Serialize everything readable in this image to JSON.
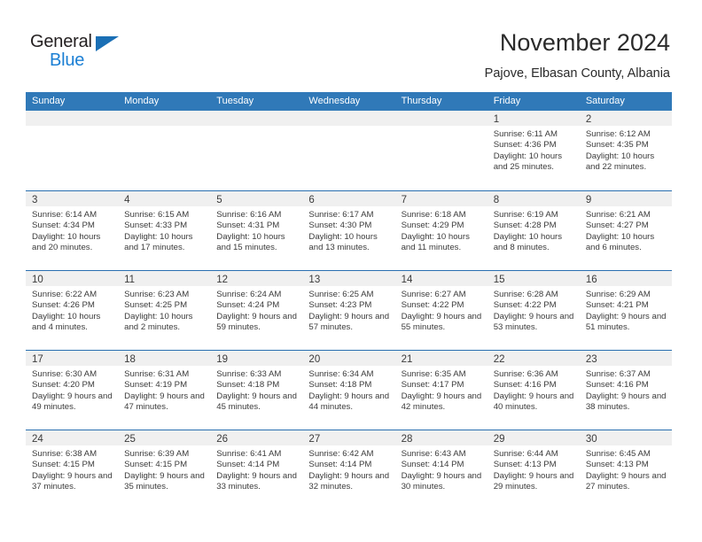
{
  "brand": {
    "name_top": "General",
    "name_bottom": "Blue",
    "accent_color": "#1b7fd4",
    "triangle_color": "#1a6fb5"
  },
  "header": {
    "title": "November 2024",
    "subtitle": "Pajove, Elbasan County, Albania"
  },
  "theme": {
    "header_row_bg": "#3079b8",
    "week_separator": "#2a6fb0",
    "day_band_bg": "#f0f0f0",
    "text_color": "#3b3b3b"
  },
  "weekdays": [
    "Sunday",
    "Monday",
    "Tuesday",
    "Wednesday",
    "Thursday",
    "Friday",
    "Saturday"
  ],
  "labels": {
    "sunrise_prefix": "Sunrise:",
    "sunset_prefix": "Sunset:",
    "daylight_prefix": "Daylight:"
  },
  "weeks": [
    [
      {
        "empty": true
      },
      {
        "empty": true
      },
      {
        "empty": true
      },
      {
        "empty": true
      },
      {
        "empty": true
      },
      {
        "day": "1",
        "sunrise": "Sunrise: 6:11 AM",
        "sunset": "Sunset: 4:36 PM",
        "daylight": "Daylight: 10 hours and 25 minutes."
      },
      {
        "day": "2",
        "sunrise": "Sunrise: 6:12 AM",
        "sunset": "Sunset: 4:35 PM",
        "daylight": "Daylight: 10 hours and 22 minutes."
      }
    ],
    [
      {
        "day": "3",
        "sunrise": "Sunrise: 6:14 AM",
        "sunset": "Sunset: 4:34 PM",
        "daylight": "Daylight: 10 hours and 20 minutes."
      },
      {
        "day": "4",
        "sunrise": "Sunrise: 6:15 AM",
        "sunset": "Sunset: 4:33 PM",
        "daylight": "Daylight: 10 hours and 17 minutes."
      },
      {
        "day": "5",
        "sunrise": "Sunrise: 6:16 AM",
        "sunset": "Sunset: 4:31 PM",
        "daylight": "Daylight: 10 hours and 15 minutes."
      },
      {
        "day": "6",
        "sunrise": "Sunrise: 6:17 AM",
        "sunset": "Sunset: 4:30 PM",
        "daylight": "Daylight: 10 hours and 13 minutes."
      },
      {
        "day": "7",
        "sunrise": "Sunrise: 6:18 AM",
        "sunset": "Sunset: 4:29 PM",
        "daylight": "Daylight: 10 hours and 11 minutes."
      },
      {
        "day": "8",
        "sunrise": "Sunrise: 6:19 AM",
        "sunset": "Sunset: 4:28 PM",
        "daylight": "Daylight: 10 hours and 8 minutes."
      },
      {
        "day": "9",
        "sunrise": "Sunrise: 6:21 AM",
        "sunset": "Sunset: 4:27 PM",
        "daylight": "Daylight: 10 hours and 6 minutes."
      }
    ],
    [
      {
        "day": "10",
        "sunrise": "Sunrise: 6:22 AM",
        "sunset": "Sunset: 4:26 PM",
        "daylight": "Daylight: 10 hours and 4 minutes."
      },
      {
        "day": "11",
        "sunrise": "Sunrise: 6:23 AM",
        "sunset": "Sunset: 4:25 PM",
        "daylight": "Daylight: 10 hours and 2 minutes."
      },
      {
        "day": "12",
        "sunrise": "Sunrise: 6:24 AM",
        "sunset": "Sunset: 4:24 PM",
        "daylight": "Daylight: 9 hours and 59 minutes."
      },
      {
        "day": "13",
        "sunrise": "Sunrise: 6:25 AM",
        "sunset": "Sunset: 4:23 PM",
        "daylight": "Daylight: 9 hours and 57 minutes."
      },
      {
        "day": "14",
        "sunrise": "Sunrise: 6:27 AM",
        "sunset": "Sunset: 4:22 PM",
        "daylight": "Daylight: 9 hours and 55 minutes."
      },
      {
        "day": "15",
        "sunrise": "Sunrise: 6:28 AM",
        "sunset": "Sunset: 4:22 PM",
        "daylight": "Daylight: 9 hours and 53 minutes."
      },
      {
        "day": "16",
        "sunrise": "Sunrise: 6:29 AM",
        "sunset": "Sunset: 4:21 PM",
        "daylight": "Daylight: 9 hours and 51 minutes."
      }
    ],
    [
      {
        "day": "17",
        "sunrise": "Sunrise: 6:30 AM",
        "sunset": "Sunset: 4:20 PM",
        "daylight": "Daylight: 9 hours and 49 minutes."
      },
      {
        "day": "18",
        "sunrise": "Sunrise: 6:31 AM",
        "sunset": "Sunset: 4:19 PM",
        "daylight": "Daylight: 9 hours and 47 minutes."
      },
      {
        "day": "19",
        "sunrise": "Sunrise: 6:33 AM",
        "sunset": "Sunset: 4:18 PM",
        "daylight": "Daylight: 9 hours and 45 minutes."
      },
      {
        "day": "20",
        "sunrise": "Sunrise: 6:34 AM",
        "sunset": "Sunset: 4:18 PM",
        "daylight": "Daylight: 9 hours and 44 minutes."
      },
      {
        "day": "21",
        "sunrise": "Sunrise: 6:35 AM",
        "sunset": "Sunset: 4:17 PM",
        "daylight": "Daylight: 9 hours and 42 minutes."
      },
      {
        "day": "22",
        "sunrise": "Sunrise: 6:36 AM",
        "sunset": "Sunset: 4:16 PM",
        "daylight": "Daylight: 9 hours and 40 minutes."
      },
      {
        "day": "23",
        "sunrise": "Sunrise: 6:37 AM",
        "sunset": "Sunset: 4:16 PM",
        "daylight": "Daylight: 9 hours and 38 minutes."
      }
    ],
    [
      {
        "day": "24",
        "sunrise": "Sunrise: 6:38 AM",
        "sunset": "Sunset: 4:15 PM",
        "daylight": "Daylight: 9 hours and 37 minutes."
      },
      {
        "day": "25",
        "sunrise": "Sunrise: 6:39 AM",
        "sunset": "Sunset: 4:15 PM",
        "daylight": "Daylight: 9 hours and 35 minutes."
      },
      {
        "day": "26",
        "sunrise": "Sunrise: 6:41 AM",
        "sunset": "Sunset: 4:14 PM",
        "daylight": "Daylight: 9 hours and 33 minutes."
      },
      {
        "day": "27",
        "sunrise": "Sunrise: 6:42 AM",
        "sunset": "Sunset: 4:14 PM",
        "daylight": "Daylight: 9 hours and 32 minutes."
      },
      {
        "day": "28",
        "sunrise": "Sunrise: 6:43 AM",
        "sunset": "Sunset: 4:14 PM",
        "daylight": "Daylight: 9 hours and 30 minutes."
      },
      {
        "day": "29",
        "sunrise": "Sunrise: 6:44 AM",
        "sunset": "Sunset: 4:13 PM",
        "daylight": "Daylight: 9 hours and 29 minutes."
      },
      {
        "day": "30",
        "sunrise": "Sunrise: 6:45 AM",
        "sunset": "Sunset: 4:13 PM",
        "daylight": "Daylight: 9 hours and 27 minutes."
      }
    ]
  ]
}
